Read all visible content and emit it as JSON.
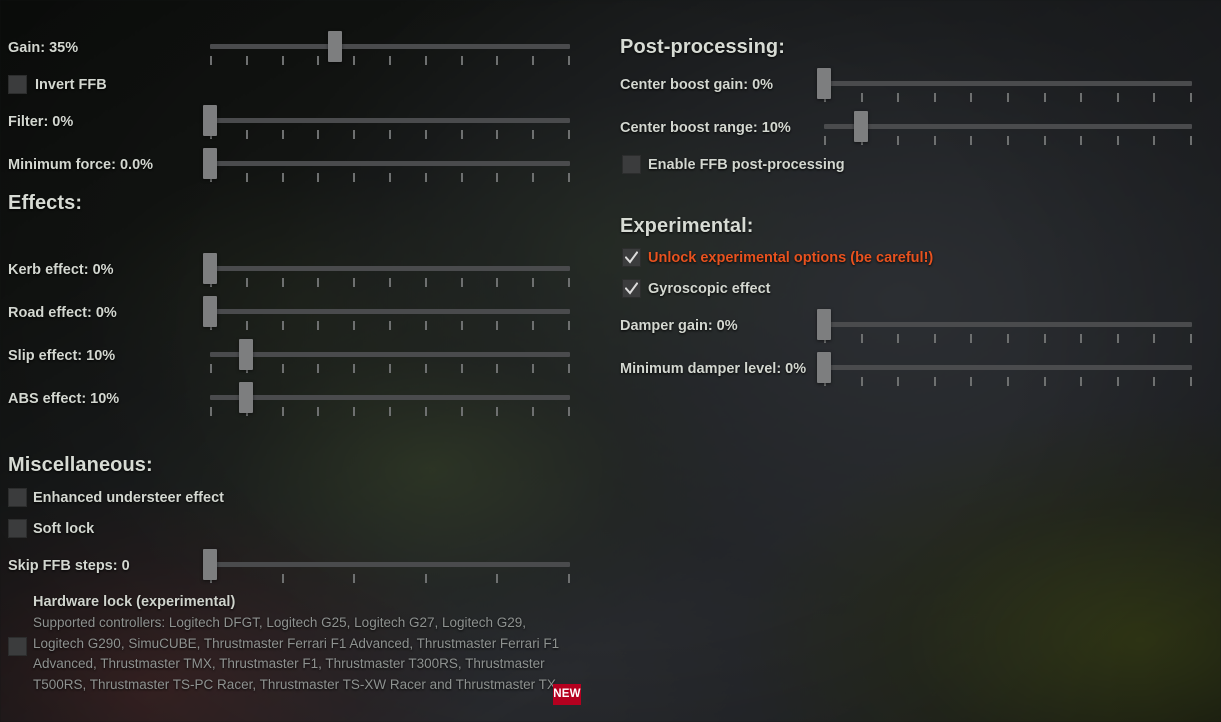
{
  "colors": {
    "accent_warning": "#e8521f",
    "badge_background": "#b5001f",
    "label_text": "#d3d7d0",
    "muted_text": "#8e9290",
    "slider_handle": "#7d7e7f",
    "slider_track": "#4a4b4d",
    "checkbox_background": "#3b3c3d"
  },
  "left_column": {
    "force_feedback": {
      "controls": [
        {
          "name": "gain",
          "label": "Gain: 35%",
          "value": 35,
          "min": 0,
          "max": 100,
          "ticks": 11,
          "type": "slider"
        },
        {
          "name": "invert-ffb",
          "label": "Invert FFB",
          "checked": false,
          "type": "checkbox"
        },
        {
          "name": "filter",
          "label": "Filter: 0%",
          "value": 0,
          "min": 0,
          "max": 100,
          "ticks": 11,
          "type": "slider"
        },
        {
          "name": "minimum-force",
          "label": "Minimum force: 0.0%",
          "value": 0,
          "min": 0,
          "max": 100,
          "ticks": 11,
          "type": "slider"
        }
      ]
    },
    "effects": {
      "title": "Effects:",
      "controls": [
        {
          "name": "kerb-effect",
          "label": "Kerb effect: 0%",
          "value": 0,
          "min": 0,
          "max": 100,
          "ticks": 11,
          "type": "slider"
        },
        {
          "name": "road-effect",
          "label": "Road effect: 0%",
          "value": 0,
          "min": 0,
          "max": 100,
          "ticks": 11,
          "type": "slider"
        },
        {
          "name": "slip-effect",
          "label": "Slip effect: 10%",
          "value": 10,
          "min": 0,
          "max": 100,
          "ticks": 11,
          "type": "slider"
        },
        {
          "name": "abs-effect",
          "label": "ABS effect: 10%",
          "value": 10,
          "min": 0,
          "max": 100,
          "ticks": 11,
          "type": "slider"
        }
      ]
    },
    "miscellaneous": {
      "title": "Miscellaneous:",
      "controls": [
        {
          "name": "enhanced-understeer-effect",
          "label": "Enhanced understeer effect",
          "checked": false,
          "type": "checkbox"
        },
        {
          "name": "soft-lock",
          "label": "Soft lock",
          "checked": false,
          "type": "checkbox"
        },
        {
          "name": "skip-ffb-steps",
          "label": "Skip FFB steps: 0",
          "value": 0,
          "min": 0,
          "max": 5,
          "ticks": 6,
          "type": "slider"
        }
      ],
      "hardware_lock": {
        "name": "hardware-lock",
        "label": "Hardware lock (experimental)",
        "checked": false,
        "description": "Supported controllers: Logitech DFGT, Logitech G25, Logitech G27, Logitech G29, Logitech G290, SimuCUBE, Thrustmaster Ferrari F1 Advanced, Thrustmaster Ferrari F1 Advanced, Thrustmaster TMX, Thrustmaster F1, Thrustmaster T300RS, Thrustmaster T500RS, Thrustmaster TS-PC Racer, Thrustmaster TS-XW Racer and Thrustmaster TX",
        "badge": "NEW"
      }
    }
  },
  "right_column": {
    "post_processing": {
      "title": "Post-processing:",
      "controls": [
        {
          "name": "center-boost-gain",
          "label": "Center boost gain: 0%",
          "value": 0,
          "min": 0,
          "max": 100,
          "ticks": 11,
          "type": "slider"
        },
        {
          "name": "center-boost-range",
          "label": "Center boost range: 10%",
          "value": 10,
          "min": 0,
          "max": 100,
          "ticks": 11,
          "type": "slider"
        },
        {
          "name": "enable-ffb-postprocessing",
          "label": "Enable FFB post-processing",
          "checked": false,
          "type": "checkbox"
        }
      ]
    },
    "experimental": {
      "title": "Experimental:",
      "controls": [
        {
          "name": "unlock-experimental-options",
          "label": "Unlock experimental options (be careful!)",
          "checked": true,
          "highlight": true,
          "type": "checkbox"
        },
        {
          "name": "gyroscopic-effect",
          "label": "Gyroscopic effect",
          "checked": true,
          "type": "checkbox"
        },
        {
          "name": "damper-gain",
          "label": "Damper gain: 0%",
          "value": 0,
          "min": 0,
          "max": 100,
          "ticks": 11,
          "type": "slider"
        },
        {
          "name": "minimum-damper-level",
          "label": "Minimum damper level: 0%",
          "value": 0,
          "min": 0,
          "max": 100,
          "ticks": 11,
          "type": "slider"
        }
      ]
    }
  }
}
